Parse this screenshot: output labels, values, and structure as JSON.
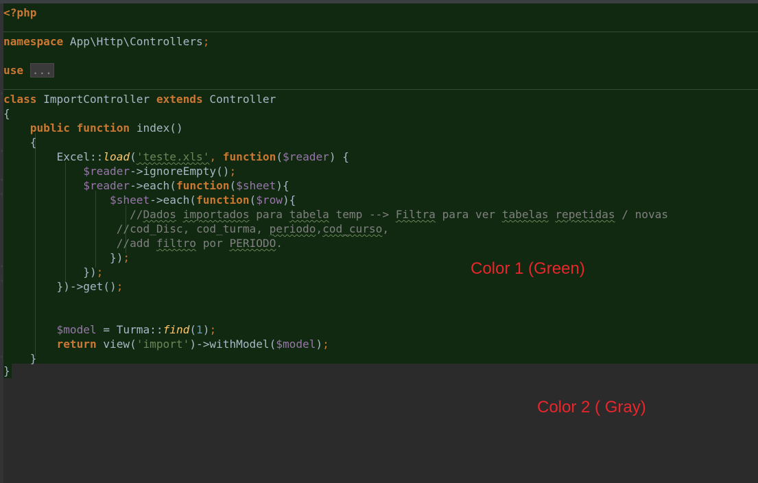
{
  "code_lines": {
    "l1": "<?php",
    "l2a": "namespace ",
    "l2b": "App\\Http\\Controllers",
    "l2c": ";",
    "l3a": "use ",
    "l3b": "...",
    "l4a": "class ",
    "l4b": "ImportController ",
    "l4c": "extends ",
    "l4d": "Controller",
    "l5": "{",
    "l6a": "    public ",
    "l6b": "function ",
    "l6c": "index()",
    "l7": "    {",
    "l8a": "        Excel::",
    "l8b": "load",
    "l8c": "(",
    "l8d": "'teste.xls'",
    "l8e": ", ",
    "l8f": "function",
    "l8g": "(",
    "l8h": "$reader",
    "l8i": ") {",
    "l9a": "            ",
    "l9b": "$reader",
    "l9c": "->ignoreEmpty()",
    "l9d": ";",
    "l10a": "            ",
    "l10b": "$reader",
    "l10c": "->each(",
    "l10d": "function",
    "l10e": "(",
    "l10f": "$sheet",
    "l10g": "){",
    "l11a": "                ",
    "l11b": "$sheet",
    "l11c": "->each(",
    "l11d": "function",
    "l11e": "(",
    "l11f": "$row",
    "l11g": "){",
    "l12a": "                   //",
    "l12b": "Dados",
    "l12c": " ",
    "l12d": "importados",
    "l12e": " para ",
    "l12f": "tabela",
    "l12g": " temp --> ",
    "l12h": "Filtra",
    "l12i": " para ver ",
    "l12j": "tabelas",
    "l12k": " ",
    "l12l": "repetidas",
    "l12m": " / novas",
    "l13a": "                 //cod_Disc, cod_turma, ",
    "l13b": "periodo",
    "l13c": ",",
    "l13d": "cod_curso",
    "l13e": ",",
    "l14a": "                 //add ",
    "l14b": "filtro",
    "l14c": " por ",
    "l14d": "PERIODO",
    "l14e": ".",
    "l15a": "                })",
    "l15b": ";",
    "l16a": "            })",
    "l16b": ";",
    "l17a": "        })->get()",
    "l17b": ";",
    "l18a": "        ",
    "l18b": "$model",
    "l18c": " = Turma::",
    "l18d": "find",
    "l18e": "(",
    "l18f": "1",
    "l18g": ")",
    "l18h": ";",
    "l19a": "        ",
    "l19b": "return ",
    "l19c": "view(",
    "l19d": "'import'",
    "l19e": ")->withModel(",
    "l19f": "$model",
    "l19g": ")",
    "l19h": ";",
    "l20": "    }",
    "l21": "}"
  },
  "annotations": {
    "color1": "Color 1 (Green)",
    "color2": "Color 2 ( Gray)"
  },
  "colors": {
    "green_background": "#102910",
    "gray_background": "#2b2b2b",
    "annotation_red": "#e8262c",
    "keyword_orange": "#cc7832",
    "variable_purple": "#9876aa",
    "string_green": "#6a8759",
    "comment_gray": "#808080"
  }
}
